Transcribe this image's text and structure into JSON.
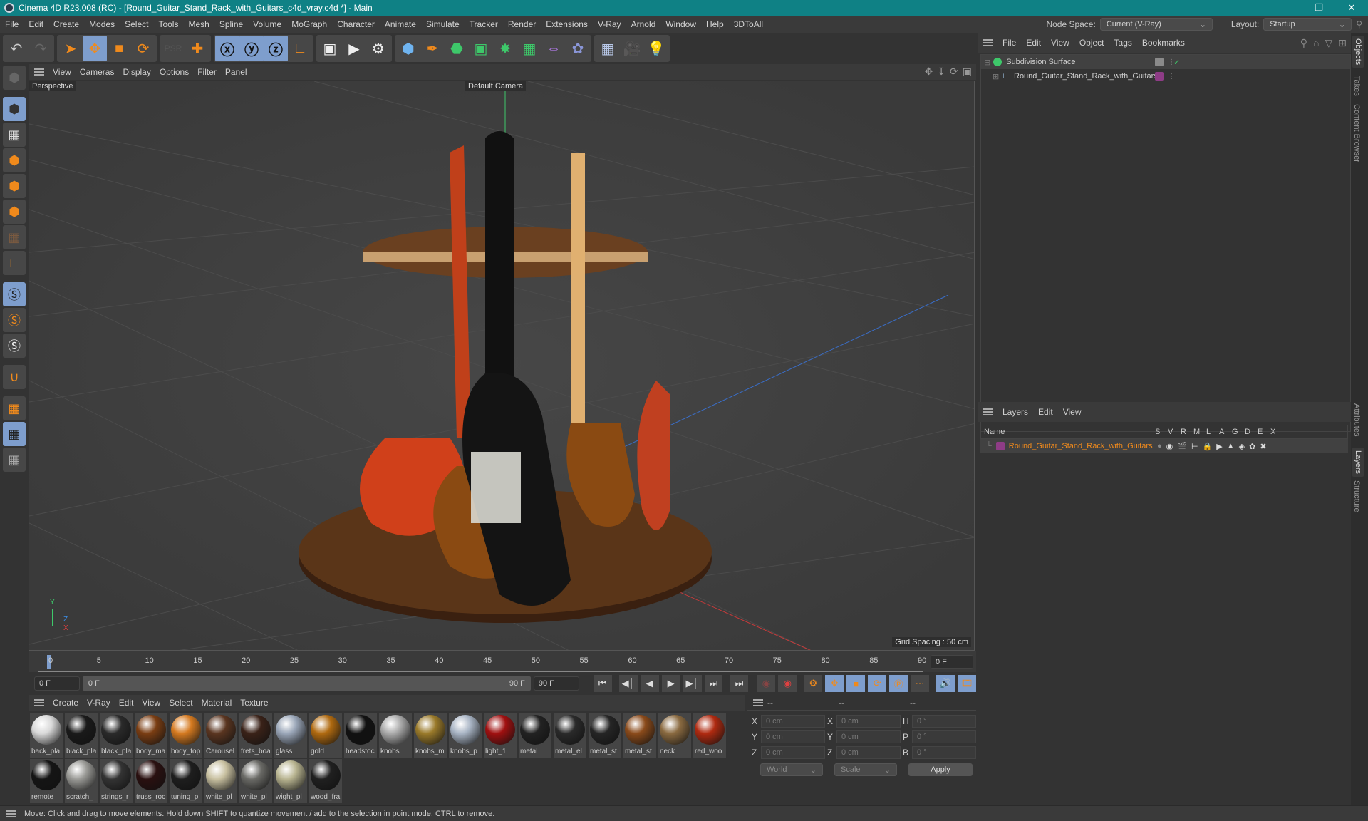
{
  "window": {
    "title": "Cinema 4D R23.008 (RC) - [Round_Guitar_Stand_Rack_with_Guitars_c4d_vray.c4d *] - Main",
    "controls": [
      "minimize",
      "restore",
      "close"
    ]
  },
  "menubar": {
    "items": [
      "File",
      "Edit",
      "Create",
      "Modes",
      "Select",
      "Tools",
      "Mesh",
      "Spline",
      "Volume",
      "MoGraph",
      "Character",
      "Animate",
      "Simulate",
      "Tracker",
      "Render",
      "Extensions",
      "V-Ray",
      "Arnold",
      "Window",
      "Help",
      "3DToAll"
    ],
    "node_space_label": "Node Space:",
    "node_space_value": "Current (V-Ray)",
    "layout_label": "Layout:",
    "layout_value": "Startup"
  },
  "toolbar": {
    "groups": [
      [
        "undo-icon",
        "redo-icon"
      ],
      [
        "select-icon",
        "move-icon",
        "scale-icon",
        "rotate-icon"
      ],
      [
        "psr-icon",
        "coordinate-add-icon"
      ],
      [
        "x-axis-icon",
        "y-axis-icon",
        "z-axis-icon",
        "world-coords-icon"
      ],
      [
        "render-view-icon",
        "render-picture-viewer-icon",
        "render-settings-icon"
      ],
      [
        "cube-icon",
        "pen-icon",
        "subdivision-icon",
        "extrude-icon",
        "cloner-icon",
        "array-icon",
        "symmetry-icon",
        "deformer-icon"
      ],
      [
        "floor-icon",
        "camera-icon",
        "light-icon"
      ]
    ]
  },
  "leftbar": {
    "items": [
      "make-editable-icon",
      "model-mode-icon",
      "texture-mode-icon",
      "points-mode-icon",
      "edges-mode-icon",
      "polygons-mode-icon",
      "uv-mode-icon",
      "axis-icon",
      "snap-icon",
      "snap-settings-icon",
      "soft-selection-icon",
      "magnet-icon",
      "workplane-icon",
      "locked-workplane-icon",
      "align-workplane-icon"
    ]
  },
  "viewport": {
    "menu": [
      "View",
      "Cameras",
      "Display",
      "Options",
      "Filter",
      "Panel"
    ],
    "projection": "Perspective",
    "camera": "Default Camera",
    "grid_spacing": "Grid Spacing : 50 cm",
    "axis_labels": {
      "x": "X",
      "y": "Y",
      "z": "Z"
    }
  },
  "timeline": {
    "ticks": [
      "0",
      "5",
      "10",
      "15",
      "20",
      "25",
      "30",
      "35",
      "40",
      "45",
      "50",
      "55",
      "60",
      "65",
      "70",
      "75",
      "80",
      "85",
      "90"
    ],
    "current_frame": "0 F",
    "start_field": "0 F",
    "range_start": "0 F",
    "range_end": "90 F",
    "end_field": "90 F"
  },
  "materials": {
    "menu": [
      "Create",
      "V-Ray",
      "Edit",
      "View",
      "Select",
      "Material",
      "Texture"
    ],
    "items": [
      {
        "name": "back_pla",
        "color": "#d9d9d9"
      },
      {
        "name": "black_pla",
        "color": "#1a1a1a"
      },
      {
        "name": "black_pla",
        "color": "#2a2a2a"
      },
      {
        "name": "body_ma",
        "color": "#7a3d12"
      },
      {
        "name": "body_top",
        "color": "#d57a20"
      },
      {
        "name": "Carousel",
        "color": "#5a3520"
      },
      {
        "name": "frets_boa",
        "color": "#3a2218"
      },
      {
        "name": "glass",
        "color": "#9aa6b8"
      },
      {
        "name": "gold",
        "color": "#b06a10"
      },
      {
        "name": "headstoc",
        "color": "#111111"
      },
      {
        "name": "knobs",
        "color": "#aaaaaa"
      },
      {
        "name": "knobs_m",
        "color": "#9a7a2a"
      },
      {
        "name": "knobs_p",
        "color": "#a8b4c4"
      },
      {
        "name": "light_1",
        "color": "#a01010"
      },
      {
        "name": "metal",
        "color": "#222222"
      },
      {
        "name": "metal_el",
        "color": "#2a2a2a"
      },
      {
        "name": "metal_st",
        "color": "#252525"
      },
      {
        "name": "metal_st",
        "color": "#8a4a1a"
      },
      {
        "name": "neck",
        "color": "#8a6a40"
      },
      {
        "name": "red_woo",
        "color": "#b02a10"
      },
      {
        "name": "remote",
        "color": "#151515"
      },
      {
        "name": "scratch_",
        "color": "#9a9a96"
      },
      {
        "name": "strings_r",
        "color": "#333333"
      },
      {
        "name": "truss_roc",
        "color": "#2a1010"
      },
      {
        "name": "tuning_p",
        "color": "#1e1e1e"
      },
      {
        "name": "white_pl",
        "color": "#c8c0a0"
      },
      {
        "name": "white_pl",
        "color": "#6a6a66"
      },
      {
        "name": "wight_pl",
        "color": "#b8b490"
      },
      {
        "name": "wood_fra",
        "color": "#202020"
      }
    ]
  },
  "coordinates": {
    "headers": [
      "--",
      "--",
      "--"
    ],
    "rows": [
      {
        "a": "X",
        "av": "0 cm",
        "b": "X",
        "bv": "0 cm",
        "c": "H",
        "cv": "0 °"
      },
      {
        "a": "Y",
        "av": "0 cm",
        "b": "Y",
        "bv": "0 cm",
        "c": "P",
        "cv": "0 °"
      },
      {
        "a": "Z",
        "av": "0 cm",
        "b": "Z",
        "bv": "0 cm",
        "c": "B",
        "cv": "0 °"
      }
    ],
    "space": "World",
    "mode": "Scale",
    "apply": "Apply"
  },
  "objects": {
    "menu": [
      "File",
      "Edit",
      "View",
      "Object",
      "Tags",
      "Bookmarks"
    ],
    "tree": [
      {
        "name": "Subdivision Surface",
        "level": 0,
        "color": "#3ec86a"
      },
      {
        "name": "Round_Guitar_Stand_Rack_with_Guitars",
        "level": 1,
        "layer_color": "#8e3c86"
      }
    ]
  },
  "layers": {
    "menu": [
      "Layers",
      "Edit",
      "View"
    ],
    "columns": [
      "Name",
      "S",
      "V",
      "R",
      "M",
      "L",
      "A",
      "G",
      "D",
      "E",
      "X"
    ],
    "rows": [
      {
        "name": "Round_Guitar_Stand_Rack_with_Guitars",
        "color": "#8e3c86",
        "text_color": "#f08a1c"
      }
    ]
  },
  "side_tabs": {
    "top": [
      "Objects",
      "Takes",
      "Content Browser"
    ],
    "bottom": [
      "Attributes",
      "Layers",
      "Structure"
    ]
  },
  "status": {
    "text": "Move: Click and drag to move elements. Hold down SHIFT to quantize movement / add to the selection in point mode, CTRL to remove."
  }
}
